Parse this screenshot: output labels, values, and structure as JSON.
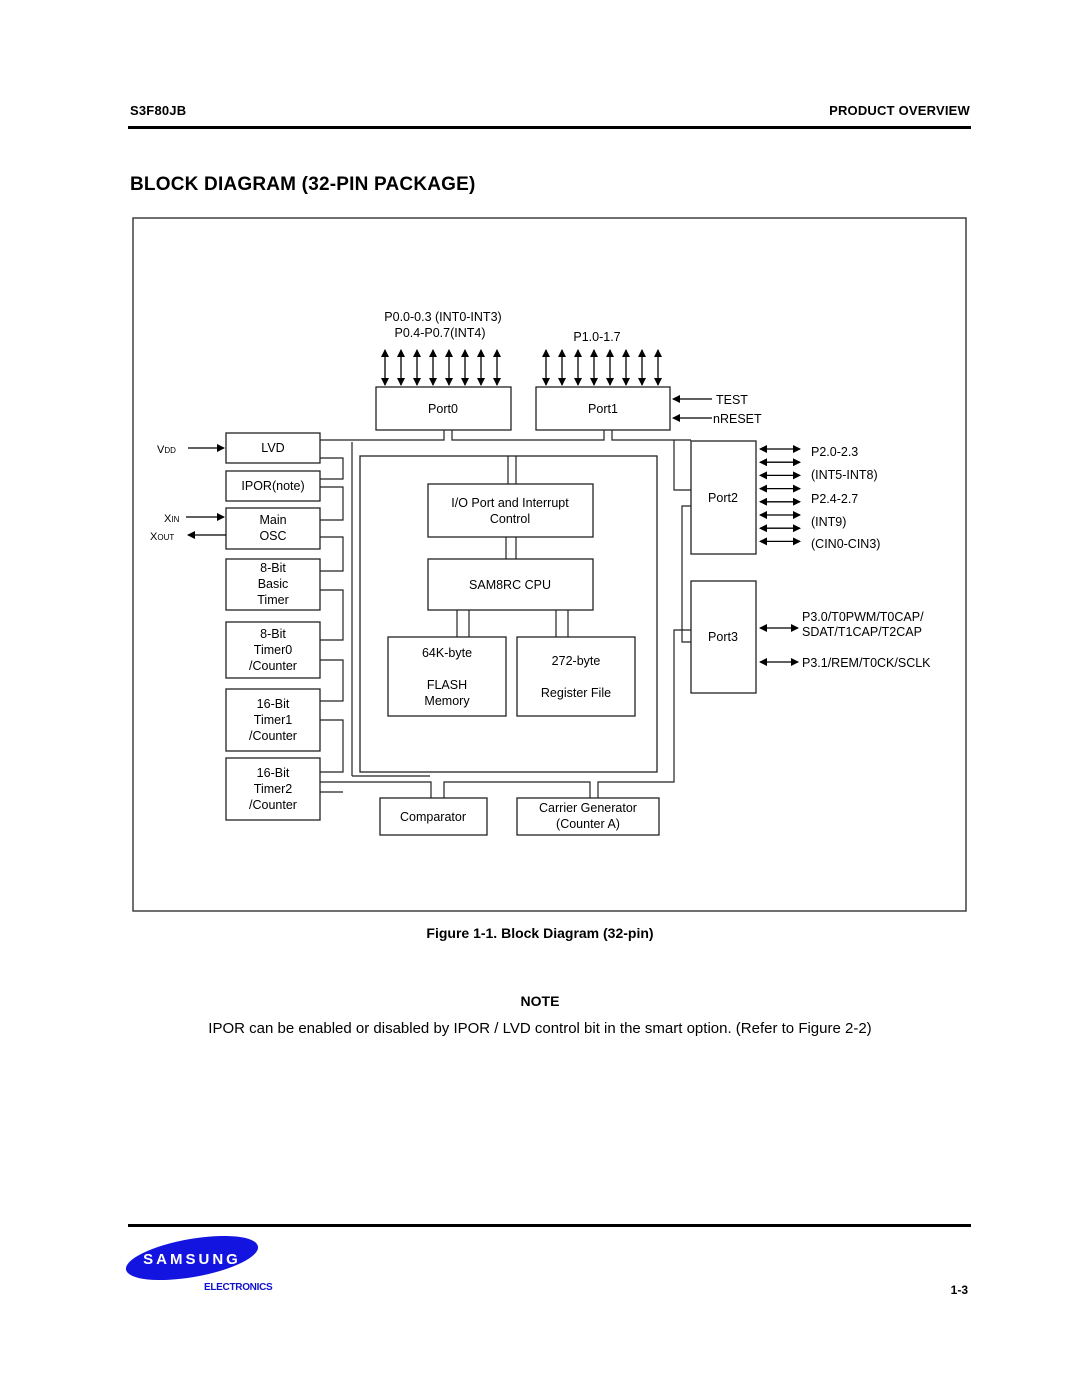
{
  "header": {
    "part_number": "S3F80JB",
    "section": "PRODUCT OVERVIEW"
  },
  "page_title": "BLOCK DIAGRAM (32-PIN PACKAGE)",
  "diagram": {
    "port0": {
      "label": "Port0",
      "pin_label_line1": "P0.0-0.3 (INT0-INT3)",
      "pin_label_line2": "P0.4-P0.7(INT4)",
      "pin_count": 8
    },
    "port1": {
      "label": "Port1",
      "pin_label": "P1.0-1.7",
      "pin_count": 8,
      "inputs": [
        "TEST",
        "nRESET"
      ]
    },
    "port2": {
      "label": "Port2",
      "pin_labels": [
        "P2.0-2.3",
        "(INT5-INT8)",
        "P2.4-2.7",
        "(INT9)",
        "(CIN0-CIN3)"
      ],
      "pin_count": 8
    },
    "port3": {
      "label": "Port3",
      "pin_labels": [
        "P3.0/T0PWM/T0CAP/",
        "SDAT/T1CAP/T2CAP",
        "P3.1/REM/T0CK/SCLK"
      ],
      "pin_count": 2
    },
    "left_blocks": {
      "lvd": {
        "label": "LVD",
        "input": "VDD"
      },
      "ipor": {
        "label": "IPOR(note)"
      },
      "osc": {
        "lines": [
          "Main",
          "OSC"
        ],
        "input": "XIN",
        "output": "XOUT"
      },
      "basic_timer": {
        "lines": [
          "8-Bit",
          "Basic",
          "Timer"
        ]
      },
      "timer0": {
        "lines": [
          "8-Bit",
          "Timer0",
          "/Counter"
        ]
      },
      "timer1": {
        "lines": [
          "16-Bit",
          "Timer1",
          "/Counter"
        ]
      },
      "timer2": {
        "lines": [
          "16-Bit",
          "Timer2",
          "/Counter"
        ]
      }
    },
    "core": {
      "io_control": {
        "lines": [
          "I/O Port and Interrupt",
          "Control"
        ]
      },
      "cpu": {
        "label": "SAM8RC CPU"
      },
      "flash": {
        "lines": [
          "64K-byte",
          "FLASH",
          "Memory"
        ]
      },
      "register_file": {
        "lines": [
          "272-byte",
          "Register File"
        ]
      }
    },
    "bottom_blocks": {
      "comparator": {
        "label": "Comparator"
      },
      "carrier": {
        "lines": [
          "Carrier Generator",
          "(Counter A)"
        ]
      }
    }
  },
  "figure_caption": "Figure 1-1. Block Diagram (32-pin)",
  "note": {
    "heading": "NOTE",
    "body": "IPOR can be enabled or disabled by IPOR / LVD control bit in the smart option. (Refer to Figure 2-2)"
  },
  "footer": {
    "logo_text": "SAMSUNG",
    "logo_subtext": "ELECTRONICS",
    "page_number": "1-3",
    "brand_color": "#1414e0"
  }
}
